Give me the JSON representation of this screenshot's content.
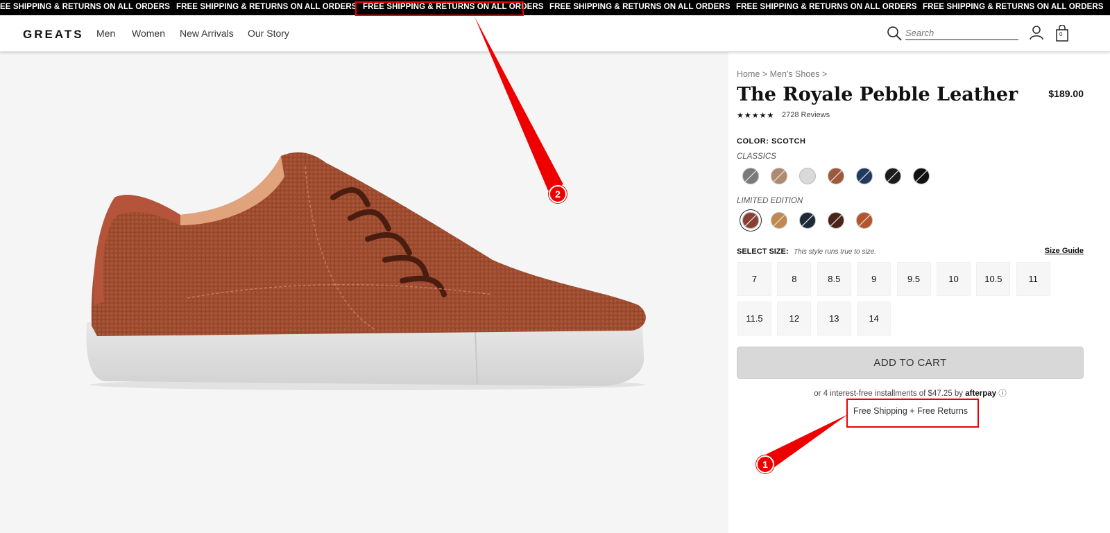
{
  "promo": {
    "items": [
      "EE SHIPPING & RETURNS ON ALL ORDERS",
      "FREE SHIPPING & RETURNS ON ALL ORDERS",
      "FREE SHIPPING & RETURNS ON ALL ORDERS",
      "FREE SHIPPING & RETURNS ON ALL ORDERS",
      "FREE SHIPPING & RETURNS ON ALL ORDERS",
      "FREE SHIPPING & RETURNS ON ALL ORDERS"
    ]
  },
  "header": {
    "logo": "GREATS",
    "nav": [
      "Men",
      "Women",
      "New Arrivals",
      "Our Story"
    ],
    "search_placeholder": "Search",
    "cart_count": "0"
  },
  "breadcrumb": {
    "home": "Home",
    "sep1": ">",
    "category": "Men's Shoes",
    "sep2": ">"
  },
  "product": {
    "title": "The Royale Pebble Leather",
    "price": "$189.00",
    "stars": "★★★★★",
    "reviews": "2728 Reviews"
  },
  "colors": {
    "label": "COLOR: SCOTCH",
    "classics_label": "CLASSICS",
    "limited_label": "LIMITED EDITION",
    "classics": [
      "#7a7a7a",
      "#b08a6e",
      "#d9d9d9",
      "#a0583a",
      "#1e3a5f",
      "#1c1c1c",
      "#111111"
    ],
    "limited": [
      "#8a4030",
      "#c08a4e",
      "#1d2a3a",
      "#4a2418",
      "#b4552c"
    ]
  },
  "size": {
    "label": "SELECT SIZE:",
    "note": "This style runs true to size.",
    "guide": "Size Guide",
    "options": [
      "7",
      "8",
      "8.5",
      "9",
      "9.5",
      "10",
      "10.5",
      "11",
      "11.5",
      "12",
      "13",
      "14"
    ]
  },
  "cart": {
    "add_label": "ADD TO CART",
    "installments": "or 4 interest-free installments of $47.25 by",
    "afterpay": "afterpay",
    "shipping_note": "Free Shipping + Free Returns"
  },
  "annotations": {
    "badge1": "1",
    "badge2": "2"
  }
}
